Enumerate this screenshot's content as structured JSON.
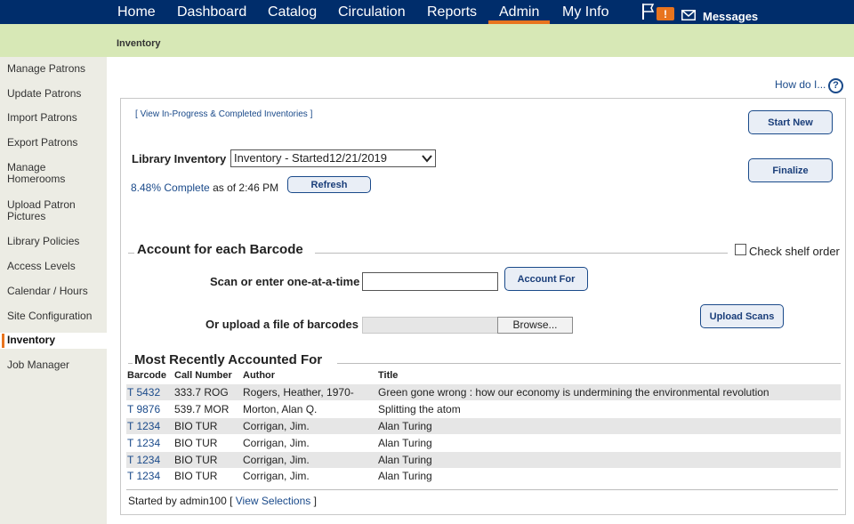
{
  "topnav": {
    "items": [
      {
        "label": "Home"
      },
      {
        "label": "Dashboard"
      },
      {
        "label": "Catalog"
      },
      {
        "label": "Circulation"
      },
      {
        "label": "Reports"
      },
      {
        "label": "Admin"
      },
      {
        "label": "My Info"
      }
    ],
    "alert_badge": "!",
    "messages_label": "Messages"
  },
  "breadcrumb": "Inventory",
  "sidebar": {
    "items": [
      {
        "label": "Manage Patrons"
      },
      {
        "label": "Update Patrons"
      },
      {
        "label": "Import Patrons"
      },
      {
        "label": "Export Patrons"
      },
      {
        "label": "Manage Homerooms"
      },
      {
        "label": "Upload Patron Pictures"
      },
      {
        "label": "Library Policies"
      },
      {
        "label": "Access Levels"
      },
      {
        "label": "Calendar / Hours"
      },
      {
        "label": "Site Configuration"
      },
      {
        "label": "Inventory"
      },
      {
        "label": "Job Manager"
      }
    ]
  },
  "help": {
    "label": "How do I...",
    "icon": "?"
  },
  "inventory": {
    "view_link_open": "[ ",
    "view_link": "View In-Progress & Completed Inventories",
    "view_link_close": " ]",
    "start_new_label": "Start New",
    "finalize_label": "Finalize",
    "library_inventory_label": "Library Inventory",
    "selected_inventory": "Inventory - Started12/21/2019",
    "percent_complete": "8.48% Complete",
    "as_of_text": "as of 2:46 PM",
    "refresh_label": "Refresh"
  },
  "account": {
    "section_title": "Account for each Barcode",
    "check_shelf_label": "Check shelf order",
    "scan_label": "Scan or enter one-at-a-time",
    "scan_value": "",
    "account_for_label": "Account For",
    "upload_label": "Or upload a file of barcodes",
    "browse_label": "Browse...",
    "upload_scans_label": "Upload Scans"
  },
  "recent": {
    "section_title": "Most Recently Accounted For",
    "columns": [
      "Barcode",
      "Call Number",
      "Author",
      "Title"
    ],
    "rows": [
      [
        "T 5432",
        "333.7 ROG",
        "Rogers, Heather, 1970-",
        "Green gone wrong : how our economy is undermining the environmental revolution"
      ],
      [
        "T 9876",
        "539.7 MOR",
        "Morton, Alan Q.",
        "Splitting the atom"
      ],
      [
        "T 1234",
        "BIO TUR",
        "Corrigan, Jim.",
        "Alan Turing"
      ],
      [
        "T 1234",
        "BIO TUR",
        "Corrigan, Jim.",
        "Alan Turing"
      ],
      [
        "T 1234",
        "BIO TUR",
        "Corrigan, Jim.",
        "Alan Turing"
      ],
      [
        "T 1234",
        "BIO TUR",
        "Corrigan, Jim.",
        "Alan Turing"
      ]
    ],
    "started_by": "Started by admin100",
    "view_selections_open": "[ ",
    "view_selections": "View Selections",
    "view_selections_close": " ]"
  },
  "colors": {
    "nav_bg": "#002d6b",
    "accent": "#e8741e",
    "subheader_bg": "#d7e8b6",
    "sidebar_bg": "#ecece4",
    "link": "#1a4a8a"
  }
}
